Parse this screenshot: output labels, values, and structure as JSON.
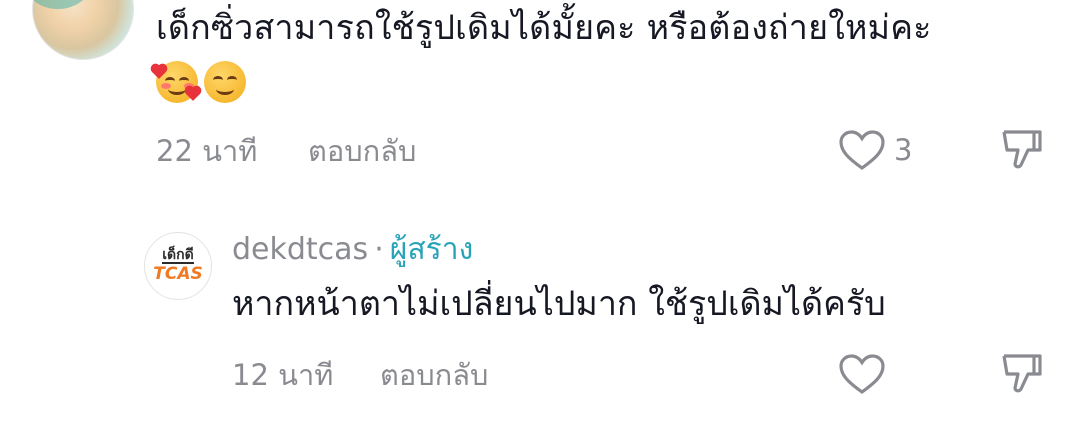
{
  "comments": [
    {
      "text_line1": "เด็กซิ่วสามารถใช้รูปเดิมได้มั้ยคะ หรือต้องถ่ายใหม่คะ",
      "emojis": [
        "smiling-face-with-hearts",
        "smiling-face-blush"
      ],
      "time": "22 นาที",
      "reply_label": "ตอบกลับ",
      "like_count": "3"
    },
    {
      "username": "dekdtcas",
      "separator": "·",
      "badge": "ผู้สร้าง",
      "avatar_top": "เด็กดี",
      "avatar_bottom": "TCAS",
      "text": "หากหน้าตาไม่เปลี่ยนไปมาก ใช้รูปเดิมได้ครับ",
      "time": "12 นาที",
      "reply_label": "ตอบกลับ"
    }
  ],
  "colors": {
    "text": "#161823",
    "meta": "#8a8b91",
    "creator_badge": "#2aa3b8",
    "logo_accent": "#f07a24"
  }
}
